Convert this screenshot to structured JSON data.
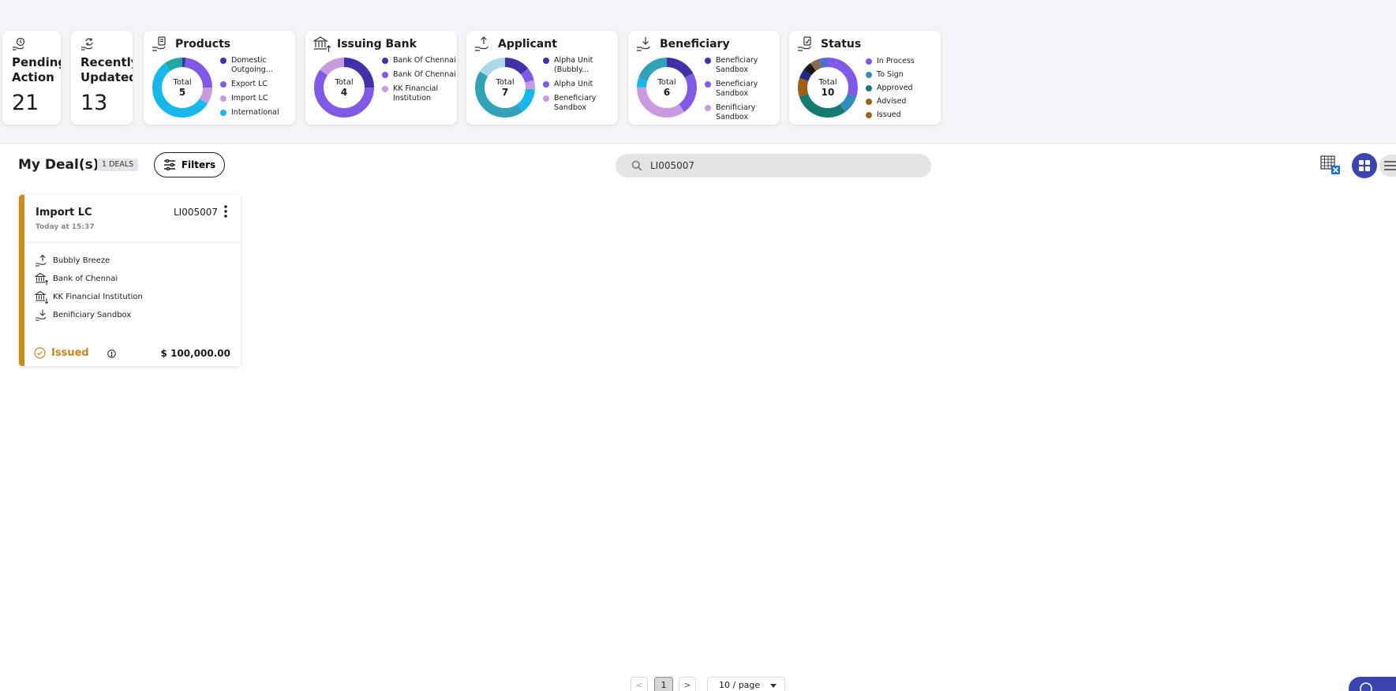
{
  "kpis": {
    "pending": {
      "label": "Pending Action",
      "value": "21"
    },
    "recent": {
      "label": "Recently Updated",
      "value": "13"
    }
  },
  "widgets": {
    "products": {
      "title": "Products",
      "total_label": "Total",
      "total": "5",
      "legend": [
        {
          "label": "Domestic Outgoing...",
          "color": "#4130a6"
        },
        {
          "label": "Export LC",
          "color": "#8159e8"
        },
        {
          "label": "Import LC",
          "color": "#c99ae0"
        },
        {
          "label": "International",
          "color": "#14b8ec"
        }
      ]
    },
    "issuing_bank": {
      "title": "Issuing Bank",
      "total_label": "Total",
      "total": "4",
      "legend": [
        {
          "label": "Bank Of Chennai",
          "color": "#4130a6"
        },
        {
          "label": "Bank Of Chennai",
          "color": "#8159e8"
        },
        {
          "label": "KK Financial Institution",
          "color": "#c99ae0"
        }
      ]
    },
    "applicant": {
      "title": "Applicant",
      "total_label": "Total",
      "total": "7",
      "legend": [
        {
          "label": "Alpha Unit (Bubbly...",
          "color": "#4130a6"
        },
        {
          "label": "Alpha Unit",
          "color": "#8159e8"
        },
        {
          "label": "Beneficiary Sandbox",
          "color": "#c99ae0"
        }
      ]
    },
    "beneficiary": {
      "title": "Beneficiary",
      "total_label": "Total",
      "total": "6",
      "legend": [
        {
          "label": "Beneficiary Sandbox",
          "color": "#4130a6"
        },
        {
          "label": "Beneficiary Sandbox",
          "color": "#8159e8"
        },
        {
          "label": "Benificiary Sandbox",
          "color": "#c99ae0"
        }
      ]
    },
    "status": {
      "title": "Status",
      "total_label": "Total",
      "total": "10",
      "legend": [
        {
          "label": "In Process",
          "color": "#8159e8"
        },
        {
          "label": "To Sign",
          "color": "#2f8ebd"
        },
        {
          "label": "Approved",
          "color": "#137c6e"
        },
        {
          "label": "Advised",
          "color": "#a15f12"
        },
        {
          "label": "Issued",
          "color": "#9c6514"
        }
      ]
    }
  },
  "chart_data": [
    {
      "type": "pie",
      "title": "Products",
      "total": 5,
      "series": [
        {
          "color": "#4130a6",
          "share": 0.02
        },
        {
          "color": "#8159e8",
          "share": 0.23
        },
        {
          "color": "#c99ae0",
          "share": 0.09
        },
        {
          "color": "#14b8ec",
          "share": 0.56
        },
        {
          "color": "#21a8a0",
          "share": 0.1
        }
      ]
    },
    {
      "type": "pie",
      "title": "Issuing Bank",
      "total": 4,
      "series": [
        {
          "color": "#4130a6",
          "share": 0.25
        },
        {
          "color": "#8159e8",
          "share": 0.6
        },
        {
          "color": "#c99ae0",
          "share": 0.15
        }
      ]
    },
    {
      "type": "pie",
      "title": "Applicant",
      "total": 7,
      "series": [
        {
          "color": "#4130a6",
          "share": 0.14
        },
        {
          "color": "#8159e8",
          "share": 0.07
        },
        {
          "color": "#c99ae0",
          "share": 0.05
        },
        {
          "color": "#14b8ec",
          "share": 0.14
        },
        {
          "color": "#30a3b8",
          "share": 0.44
        },
        {
          "color": "#a9d9ea",
          "share": 0.16
        }
      ]
    },
    {
      "type": "pie",
      "title": "Beneficiary",
      "total": 6,
      "series": [
        {
          "color": "#4130a6",
          "share": 0.17
        },
        {
          "color": "#8159e8",
          "share": 0.23
        },
        {
          "color": "#c99ae0",
          "share": 0.35
        },
        {
          "color": "#14b8ec",
          "share": 0.05
        },
        {
          "color": "#30a3b8",
          "share": 0.2
        }
      ]
    },
    {
      "type": "pie",
      "title": "Status",
      "total": 10,
      "series": [
        {
          "color": "#8159e8",
          "share": 0.3
        },
        {
          "color": "#2f8ebd",
          "share": 0.1
        },
        {
          "color": "#137c6e",
          "share": 0.3
        },
        {
          "color": "#a15f12",
          "share": 0.1
        },
        {
          "color": "#1f2a8c",
          "share": 0.05
        },
        {
          "color": "#1a1a1a",
          "share": 0.05
        },
        {
          "color": "#8a6b4f",
          "share": 0.05
        },
        {
          "color": "#4f6fd0",
          "share": 0.05
        }
      ]
    }
  ],
  "header": {
    "title": "My Deal(s)",
    "deal_count": "1 DEALS",
    "filters_label": "Filters"
  },
  "search": {
    "value": "LI005007",
    "icon": "search-icon"
  },
  "deal": {
    "product": "Import LC",
    "reference": "LI005007",
    "timestamp": "Today at 15:37",
    "parties": [
      "Bubbly Breeze",
      "Bank of Chennai",
      "KK Financial Institution",
      "Benificiary Sandbox"
    ],
    "status": "Issued",
    "amount": "$ 100,000.00",
    "status_color": "#c7861a",
    "accent": "#d18b14"
  },
  "pagination": {
    "page": "1",
    "prev": "<",
    "next": ">",
    "per_page": "10 / page"
  },
  "colors": {
    "primary": "#3a45b2"
  }
}
